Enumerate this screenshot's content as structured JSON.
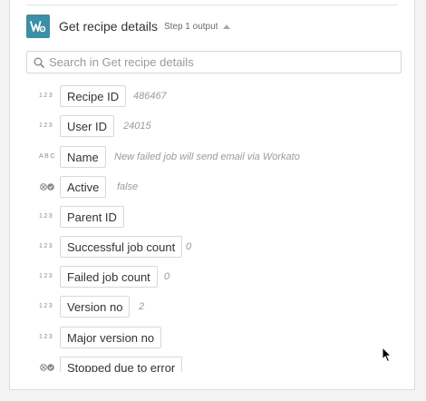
{
  "header": {
    "title": "Get recipe details",
    "subtitle": "Step 1 output",
    "logo": "workato-logo"
  },
  "search": {
    "placeholder": "Search in Get recipe details",
    "value": ""
  },
  "fields": [
    {
      "type": "123",
      "label": "Recipe ID",
      "value": "486467"
    },
    {
      "type": "123",
      "label": "User ID",
      "value": "24015"
    },
    {
      "type": "ABC",
      "label": "Name",
      "value": "New failed job will send email via Workato"
    },
    {
      "type": "boolean-icon",
      "label": "Active",
      "value": "false"
    },
    {
      "type": "123",
      "label": "Parent ID",
      "value": ""
    },
    {
      "type": "123",
      "label": "Successful job count",
      "value": "0"
    },
    {
      "type": "123",
      "label": "Failed job count",
      "value": "0"
    },
    {
      "type": "123",
      "label": "Version no",
      "value": "2"
    },
    {
      "type": "123",
      "label": "Major version no",
      "value": ""
    },
    {
      "type": "boolean-icon",
      "label": "Stopped due to error",
      "value": ""
    }
  ],
  "colors": {
    "brand": "#3b8fa6"
  }
}
